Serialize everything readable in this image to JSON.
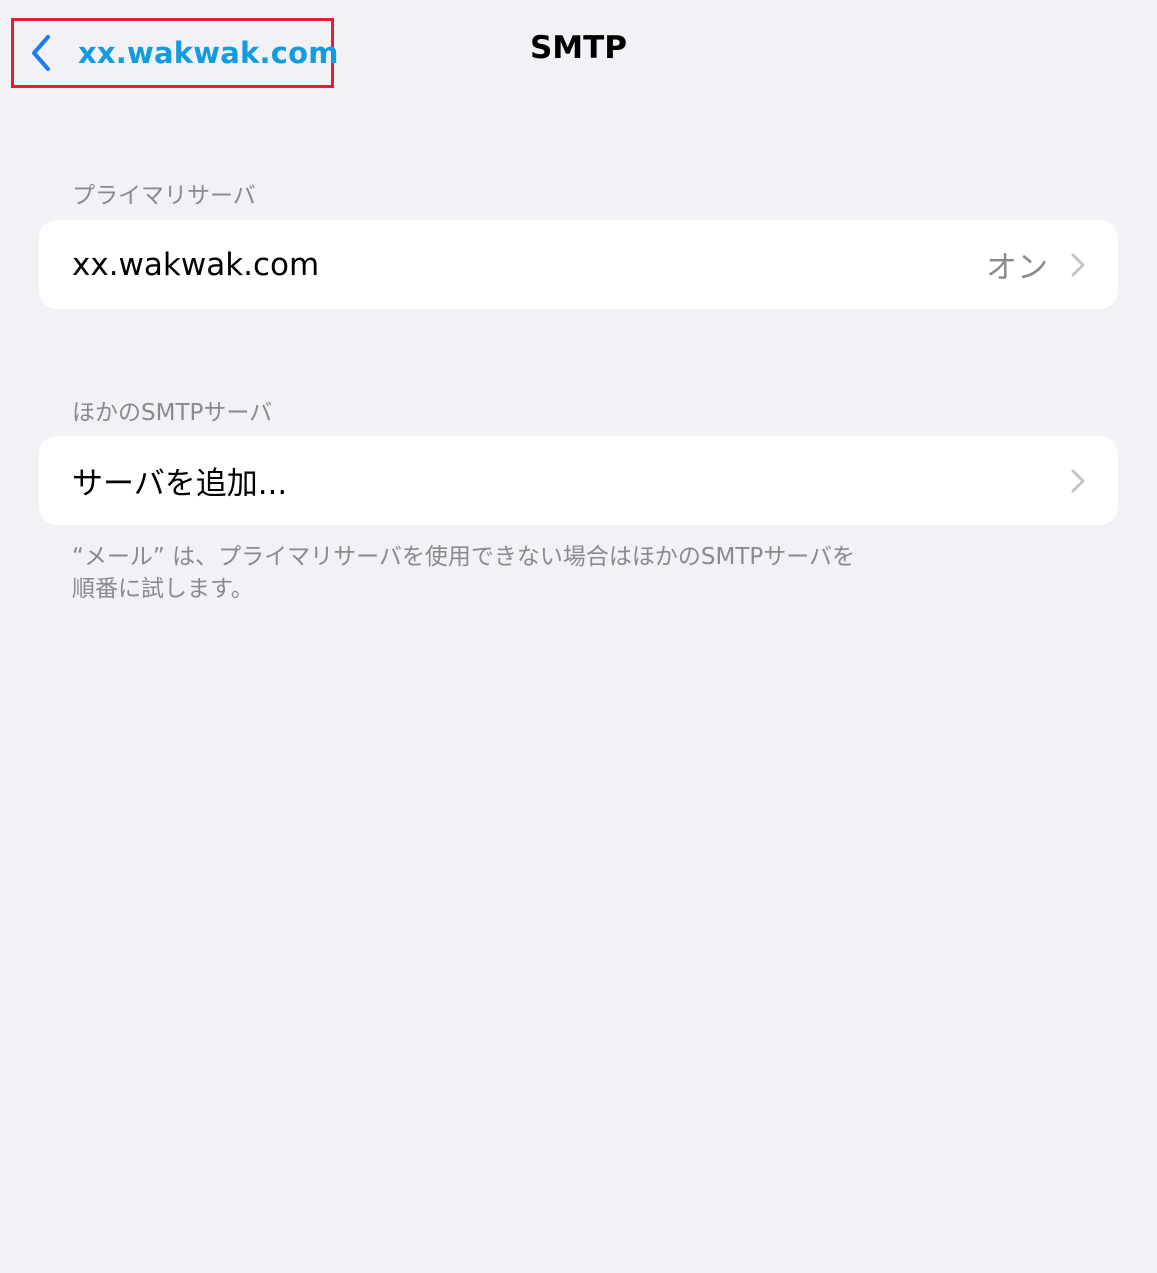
{
  "nav": {
    "back_label": "xx.wakwak.com",
    "back_icon": "chevron-left-icon",
    "title": "SMTP",
    "highlight_color": "#e0202e",
    "accent_color": "#119be0"
  },
  "primary_section": {
    "header": "プライマリサーバ",
    "server": {
      "label": "xx.wakwak.com",
      "value": "オン",
      "icon": "chevron-right-icon"
    }
  },
  "other_section": {
    "header": "ほかのSMTPサーバ",
    "add_server": {
      "label": "サーバを追加...",
      "icon": "chevron-right-icon"
    },
    "footer_line1": "“メール” は、プライマリサーバを使用できない場合はほかのSMTPサーバを",
    "footer_line2": "順番に試します。"
  }
}
